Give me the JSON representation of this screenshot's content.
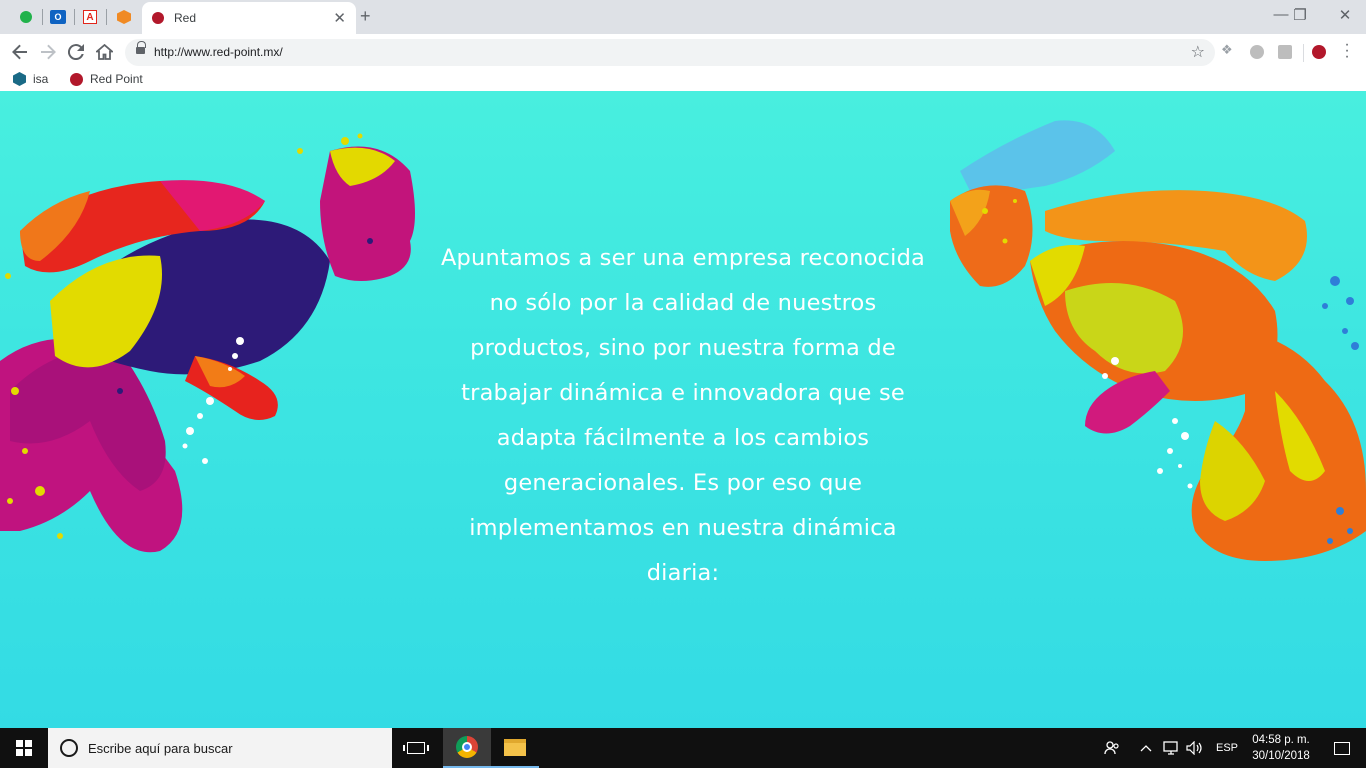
{
  "browser": {
    "pinned_tabs": [
      {
        "icon": "whatsapp-icon"
      },
      {
        "icon": "outlook-icon",
        "label": "O"
      },
      {
        "icon": "acrobat-icon",
        "label": "A"
      },
      {
        "icon": "box-icon"
      }
    ],
    "active_tab": {
      "title": "Red",
      "close": "✕"
    },
    "new_tab": "+",
    "window_controls": {
      "minimize": "—",
      "restore": "❐",
      "close": "✕"
    },
    "address": "http://www.red-point.mx/",
    "bookmarks": [
      {
        "label": "isa"
      },
      {
        "label": "Red Point"
      }
    ]
  },
  "page": {
    "mission_text": "Apuntamos a ser una empresa reconocida no sólo por la calidad de nuestros productos, sino por nuestra forma de trabajar dinámica e innovadora que se adapta fácilmente a los cambios generacionales. Es por eso que implementamos en nuestra dinámica diaria:",
    "background_color": "#3ee6e1"
  },
  "taskbar": {
    "search_placeholder": "Escribe aquí para buscar",
    "language": "ESP",
    "time": "04:58 p. m.",
    "date": "30/10/2018"
  }
}
